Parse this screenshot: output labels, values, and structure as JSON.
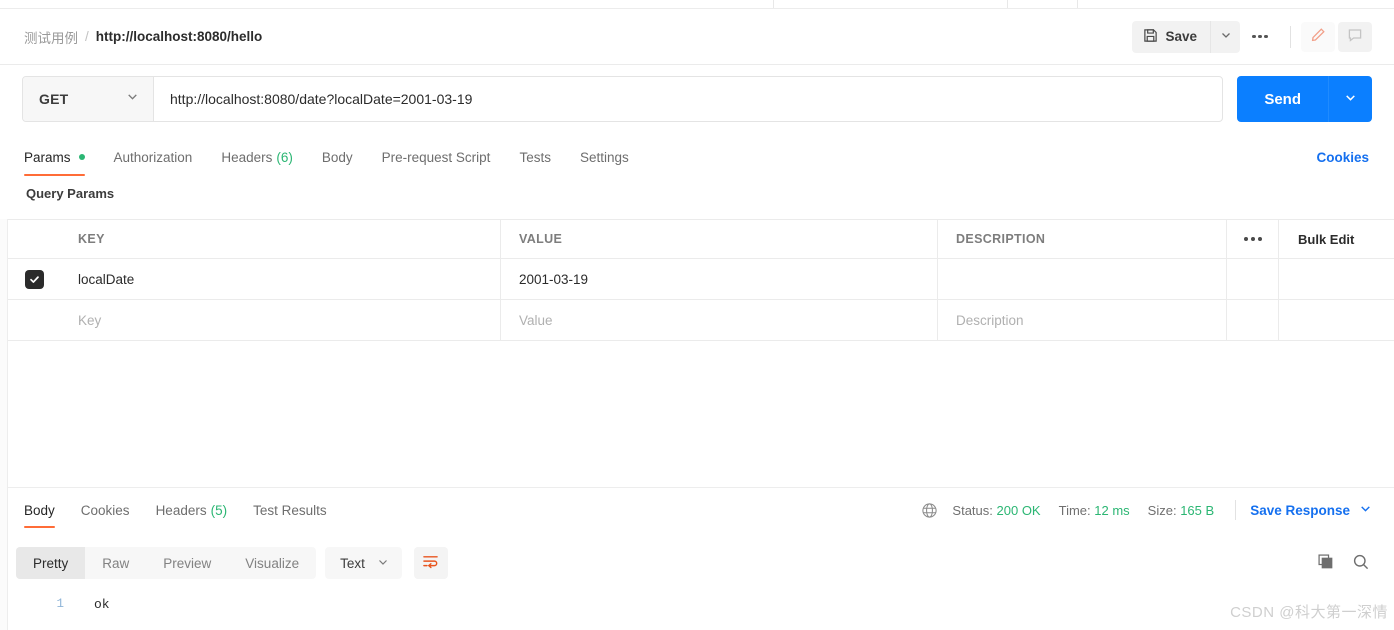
{
  "breadcrumb": {
    "folder": "测试用例",
    "separator": "/",
    "request_name": "http://localhost:8080/hello"
  },
  "header_actions": {
    "save_label": "Save",
    "save_icon": "floppy-disk-icon",
    "save_caret_icon": "chevron-down-icon",
    "more_icon": "more-horizontal-icon",
    "edit_icon": "pencil-icon",
    "comment_icon": "comment-icon",
    "accent_orange": "#ff6c37"
  },
  "url_bar": {
    "method": "GET",
    "method_caret_icon": "chevron-down-icon",
    "url": "http://localhost:8080/date?localDate=2001-03-19",
    "url_placeholder": "Enter request URL",
    "send_label": "Send",
    "send_caret_icon": "chevron-down-icon",
    "send_color": "#0b7fff"
  },
  "request_tabs": [
    {
      "label": "Params",
      "active": true,
      "dot": true
    },
    {
      "label": "Authorization",
      "active": false
    },
    {
      "label": "Headers",
      "count": "(6)",
      "active": false
    },
    {
      "label": "Body",
      "active": false
    },
    {
      "label": "Pre-request Script",
      "active": false
    },
    {
      "label": "Tests",
      "active": false
    },
    {
      "label": "Settings",
      "active": false
    }
  ],
  "cookies_link": "Cookies",
  "query_params": {
    "title": "Query Params",
    "columns": [
      "KEY",
      "VALUE",
      "DESCRIPTION"
    ],
    "menu_icon": "more-horizontal-icon",
    "bulk_edit_label": "Bulk Edit",
    "rows": [
      {
        "checked": true,
        "key": "localDate",
        "value": "2001-03-19",
        "description": ""
      }
    ],
    "placeholder_row": {
      "key": "Key",
      "value": "Value",
      "description": "Description"
    }
  },
  "response_tabs": [
    {
      "label": "Body",
      "active": true
    },
    {
      "label": "Cookies",
      "active": false
    },
    {
      "label": "Headers",
      "count": "(5)",
      "active": false
    },
    {
      "label": "Test Results",
      "active": false
    }
  ],
  "response_status": {
    "globe_icon": "globe-icon",
    "status_label": "Status:",
    "status_value": "200 OK",
    "time_label": "Time:",
    "time_value": "12 ms",
    "size_label": "Size:",
    "size_value": "165 B",
    "save_response_label": "Save Response",
    "save_response_caret_icon": "chevron-down-icon",
    "success_color": "#2bb673",
    "link_color": "#1570ef"
  },
  "body_toolbar": {
    "views": [
      {
        "label": "Pretty",
        "active": true
      },
      {
        "label": "Raw",
        "active": false
      },
      {
        "label": "Preview",
        "active": false
      },
      {
        "label": "Visualize",
        "active": false
      }
    ],
    "format": "Text",
    "format_caret_icon": "chevron-down-icon",
    "wrap_icon": "word-wrap-icon",
    "copy_icon": "copy-icon",
    "search_icon": "search-icon"
  },
  "response_body": {
    "lines": [
      {
        "number": "1",
        "text": "ok"
      }
    ]
  },
  "watermark": "CSDN @科大第一深情"
}
